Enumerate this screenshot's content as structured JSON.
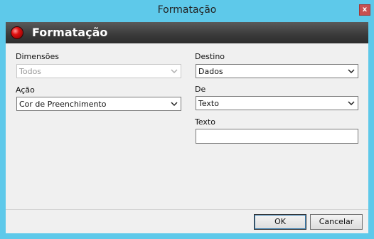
{
  "window": {
    "title": "Formatação",
    "close_label": "x"
  },
  "header": {
    "title": "Formatação",
    "icon": "red-ball-icon"
  },
  "form": {
    "dimensoes": {
      "label": "Dimensões",
      "value": "Todos",
      "disabled": true
    },
    "acao": {
      "label": "Ação",
      "value": "Cor de Preenchimento"
    },
    "destino": {
      "label": "Destino",
      "value": "Dados"
    },
    "de": {
      "label": "De",
      "value": "Texto"
    },
    "texto": {
      "label": "Texto",
      "value": ""
    }
  },
  "buttons": {
    "ok": "OK",
    "cancel": "Cancelar"
  }
}
